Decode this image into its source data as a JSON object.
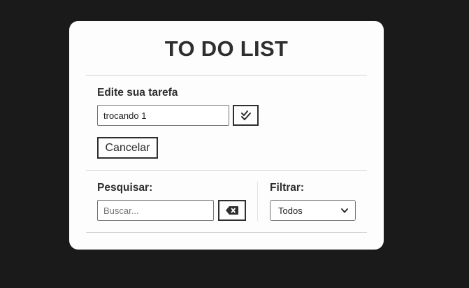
{
  "app": {
    "title": "TO DO LIST"
  },
  "edit": {
    "label": "Edite sua tarefa",
    "value": "trocando 1",
    "confirm_icon": "double-check-icon",
    "cancel_label": "Cancelar"
  },
  "search": {
    "label": "Pesquisar:",
    "placeholder": "Buscar...",
    "value": "",
    "clear_icon": "backspace-icon"
  },
  "filter": {
    "label": "Filtrar:",
    "selected": "Todos"
  },
  "colors": {
    "background": "#1a1a1a",
    "card": "#fdfdfd",
    "text": "#2e2e2e",
    "divider": "#d2d2d2"
  }
}
